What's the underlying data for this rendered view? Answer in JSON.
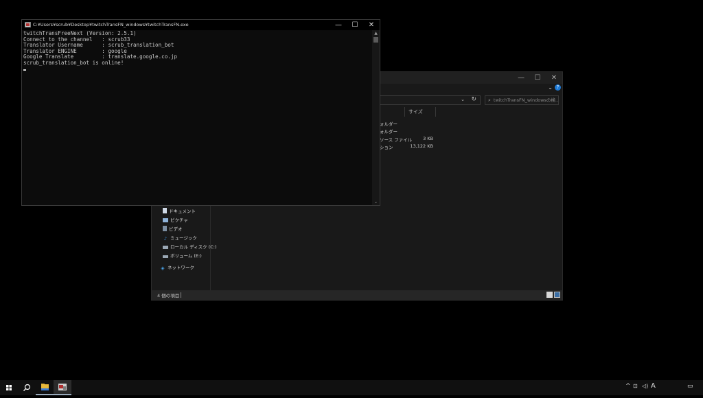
{
  "console": {
    "title": "C:¥Users¥scrub¥Desktop¥twitchTransFN_windows¥twitchTransFN.exe",
    "lines": [
      "twitchTransFreeNext (Version: 2.5.1)",
      "Connect to the channel   : scrub33",
      "Translator Username      : scrub_translation_bot",
      "Translator ENGINE        : google",
      "Google Translate         : translate.google.co.jp",
      "scrub_translation_bot is online!"
    ],
    "minimize": "—",
    "maximize": "☐",
    "close": "✕",
    "scroll_up": "▲",
    "scroll_down": "⌄"
  },
  "explorer": {
    "minimize": "—",
    "maximize": "☐",
    "close": "✕",
    "ribbon_chevron": "⌄",
    "help": "?",
    "address_dropdown": "⌄",
    "refresh": "↻",
    "search_placeholder": "twitchTransFN_windowsの検...",
    "column_size": "サイズ",
    "files": [
      {
        "type": "ォルダー",
        "size": ""
      },
      {
        "type": "ォルダー",
        "size": ""
      },
      {
        "type": "ソース ファイル",
        "size": "3 KB"
      },
      {
        "type": "ション",
        "size": "13,122 KB"
      }
    ],
    "nav": [
      {
        "label": "ドキュメント",
        "icon": "documents-icon"
      },
      {
        "label": "ピクチャ",
        "icon": "pictures-icon"
      },
      {
        "label": "ビデオ",
        "icon": "videos-icon"
      },
      {
        "label": "ミュージック",
        "icon": "music-icon"
      },
      {
        "label": "ローカル ディスク (C:)",
        "icon": "local-disk-icon"
      },
      {
        "label": "ボリューム (E:)",
        "icon": "volume-icon"
      },
      {
        "label": "ネットワーク",
        "icon": "network-icon"
      }
    ],
    "status": "4 個の項目"
  },
  "taskbar": {
    "ime": "A",
    "colors": {
      "accent": "#1e7ad6",
      "folder": "#e8b83a"
    }
  }
}
